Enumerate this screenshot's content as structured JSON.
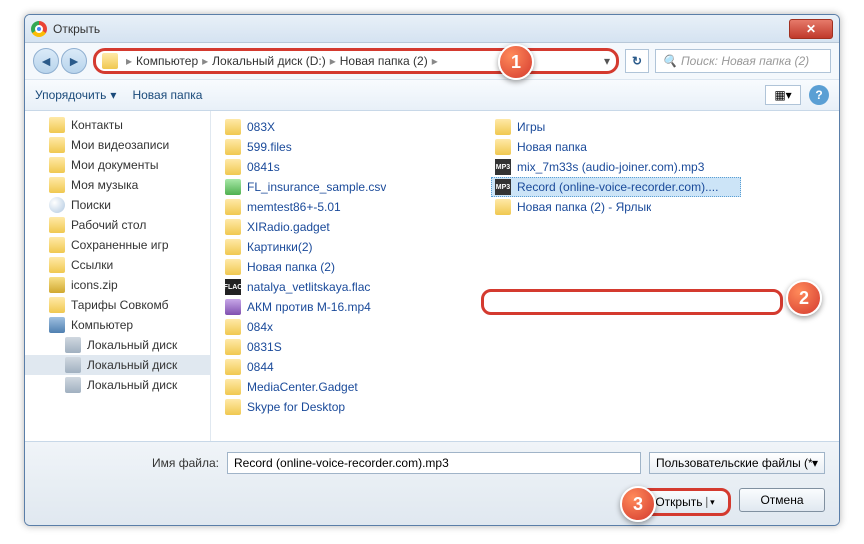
{
  "window": {
    "title": "Открыть"
  },
  "breadcrumb": {
    "seg1": "Компьютер",
    "seg2": "Локальный диск (D:)",
    "seg3": "Новая папка (2)"
  },
  "search": {
    "placeholder": "Поиск: Новая папка (2)"
  },
  "toolbar": {
    "organize": "Упорядочить",
    "newfolder": "Новая папка"
  },
  "sidebar": {
    "items": [
      {
        "label": "Контакты",
        "icon": "folder-ico"
      },
      {
        "label": "Мои видеозаписи",
        "icon": "folder-ico"
      },
      {
        "label": "Мои документы",
        "icon": "folder-ico"
      },
      {
        "label": "Моя музыка",
        "icon": "folder-ico"
      },
      {
        "label": "Поиски",
        "icon": "search-ico"
      },
      {
        "label": "Рабочий стол",
        "icon": "folder-ico"
      },
      {
        "label": "Сохраненные игр",
        "icon": "folder-ico"
      },
      {
        "label": "Ссылки",
        "icon": "folder-ico"
      },
      {
        "label": "icons.zip",
        "icon": "zip-ico"
      },
      {
        "label": "Тарифы Совкомб",
        "icon": "folder-ico"
      },
      {
        "label": "Компьютер",
        "icon": "comp-ico",
        "bold": true
      },
      {
        "label": "Локальный диск",
        "icon": "disk-ico",
        "indent": true
      },
      {
        "label": "Локальный диск",
        "icon": "disk-ico",
        "indent": true,
        "sel": true
      },
      {
        "label": "Локальный диск",
        "icon": "disk-ico",
        "indent": true
      }
    ]
  },
  "files": {
    "col1": [
      {
        "label": "083X",
        "icon": "folder-ico"
      },
      {
        "label": "599.files",
        "icon": "folder-ico"
      },
      {
        "label": "0841s",
        "icon": "folder-ico"
      },
      {
        "label": "FL_insurance_sample.csv",
        "icon": "csv-ico"
      },
      {
        "label": "memtest86+-5.01",
        "icon": "folder-ico"
      },
      {
        "label": "XIRadio.gadget",
        "icon": "folder-ico"
      },
      {
        "label": "Картинки(2)",
        "icon": "folder-ico"
      },
      {
        "label": "Новая папка (2)",
        "icon": "folder-ico"
      },
      {
        "label": "natalya_vetlitskaya.flac",
        "icon": "flac-ico"
      },
      {
        "label": "АКМ против М-16.mp4",
        "icon": "mp4-ico"
      }
    ],
    "col2": [
      {
        "label": "084x",
        "icon": "folder-ico"
      },
      {
        "label": "0831S",
        "icon": "folder-ico"
      },
      {
        "label": "0844",
        "icon": "folder-ico"
      },
      {
        "label": "MediaCenter.Gadget",
        "icon": "folder-ico"
      },
      {
        "label": "Skype for Desktop",
        "icon": "folder-ico"
      },
      {
        "label": "Игры",
        "icon": "folder-ico"
      },
      {
        "label": "Новая папка",
        "icon": "folder-ico"
      },
      {
        "label": "mix_7m33s (audio-joiner.com).mp3",
        "icon": "mp3-ico"
      },
      {
        "label": "Record (online-voice-recorder.com)....",
        "icon": "mp3-ico",
        "sel": true
      },
      {
        "label": "Новая папка (2) - Ярлык",
        "icon": "folder-ico"
      }
    ]
  },
  "footer": {
    "filename_label": "Имя файла:",
    "filename_value": "Record (online-voice-recorder.com).mp3",
    "filter": "Пользовательские файлы (*.w",
    "open": "Открыть",
    "cancel": "Отмена"
  },
  "callouts": {
    "c1": "1",
    "c2": "2",
    "c3": "3"
  }
}
